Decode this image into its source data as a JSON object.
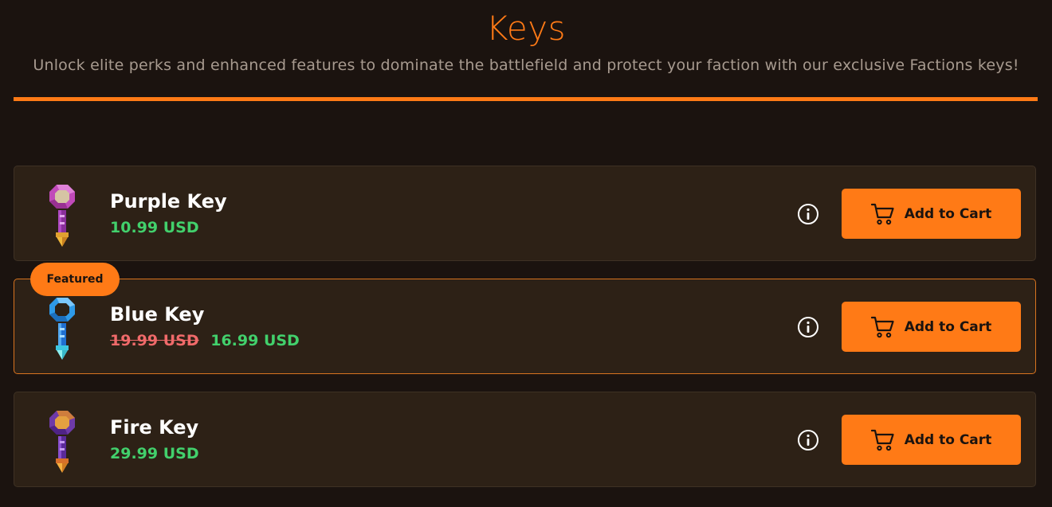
{
  "header": {
    "title": "Keys",
    "subtitle": "Unlock elite perks and enhanced features to dominate the battlefield and protect your faction with our exclusive Factions keys!"
  },
  "colors": {
    "accent": "#ff7a16",
    "background": "#1b130f",
    "card": "#2d2116",
    "price": "#42d06c",
    "old_price": "#f06a6a"
  },
  "featured_badge": "Featured",
  "products": [
    {
      "name": "Purple Key",
      "old_price": "",
      "price": "10.99 USD",
      "icon": "purple-key-icon",
      "info_icon": "info-icon",
      "cart_label": "Add to Cart",
      "cart_icon": "cart-icon",
      "featured": false
    },
    {
      "name": "Blue Key",
      "old_price": "19.99 USD",
      "price": "16.99 USD",
      "icon": "blue-key-icon",
      "info_icon": "info-icon",
      "cart_label": "Add to Cart",
      "cart_icon": "cart-icon",
      "featured": true
    },
    {
      "name": "Fire Key",
      "old_price": "",
      "price": "29.99 USD",
      "icon": "fire-key-icon",
      "info_icon": "info-icon",
      "cart_label": "Add to Cart",
      "cart_icon": "cart-icon",
      "featured": false
    }
  ]
}
